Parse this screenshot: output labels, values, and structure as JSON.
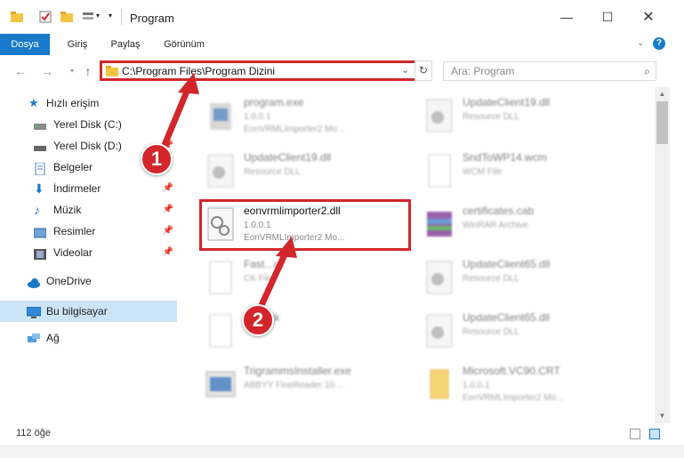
{
  "window": {
    "title": "Program"
  },
  "ribbon": {
    "tabs": [
      "Dosya",
      "Giriş",
      "Paylaş",
      "Görünüm"
    ]
  },
  "address": {
    "path": "C:\\Program Files\\Program Dizini"
  },
  "search": {
    "placeholder": "Ara: Program"
  },
  "sidebar": {
    "quick_access": "Hızlı erişim",
    "items": [
      {
        "label": "Yerel Disk (C:)",
        "icon": "drive-icon"
      },
      {
        "label": "Yerel Disk (D:)",
        "icon": "drive-icon"
      },
      {
        "label": "Belgeler",
        "icon": "documents-icon"
      },
      {
        "label": "İndirmeler",
        "icon": "downloads-icon"
      },
      {
        "label": "Müzik",
        "icon": "music-icon"
      },
      {
        "label": "Resimler",
        "icon": "pictures-icon"
      },
      {
        "label": "Videolar",
        "icon": "videos-icon"
      }
    ],
    "onedrive": "OneDrive",
    "this_pc": "Bu bilgisayar",
    "network": "Ağ"
  },
  "files": [
    {
      "name": "program.exe",
      "line2": "1.0.0.1",
      "line3": "EonVRMLImporter2 Mo...",
      "blur": true
    },
    {
      "name": "UpdateClient19.dll",
      "line2": "Resource DLL",
      "line3": "",
      "blur": true
    },
    {
      "name": "UpdateClient19.dll",
      "line2": "Resource DLL",
      "line3": "",
      "blur": true
    },
    {
      "name": "SndToWP14.wcm",
      "line2": "WCM File",
      "line3": "",
      "blur": true
    },
    {
      "name": "eonvrmlimporter2.dll",
      "line2": "1.0.0.1",
      "line3": "EonVRMLImporter2 Mo...",
      "blur": false
    },
    {
      "name": "certificates.cab",
      "line2": "WinRAR Archive",
      "line3": "",
      "blur": true
    },
    {
      "name": "Fast...ck",
      "line2": "CK File",
      "line3": "",
      "blur": true
    },
    {
      "name": "UpdateClient65.dll",
      "line2": "Resource DLL",
      "line3": "",
      "blur": true
    },
    {
      "name": "...ml.cjk",
      "line2": "",
      "line3": "",
      "blur": true
    },
    {
      "name": "UpdateClient65.dll",
      "line2": "Resource DLL",
      "line3": "",
      "blur": true
    },
    {
      "name": "TrigrammsInstaller.exe",
      "line2": "ABBYY FineReader 10 ...",
      "line3": "",
      "blur": true
    },
    {
      "name": "Microsoft.VC90.CRT",
      "line2": "1.0.0.1",
      "line3": "EonVRMLImporter2 Mo...",
      "blur": true
    }
  ],
  "status": {
    "count": "112 öğe"
  },
  "callouts": [
    "1",
    "2"
  ],
  "colors": {
    "accent": "#1979ca",
    "highlight": "#d2262b",
    "selected": "#cce4f7"
  }
}
